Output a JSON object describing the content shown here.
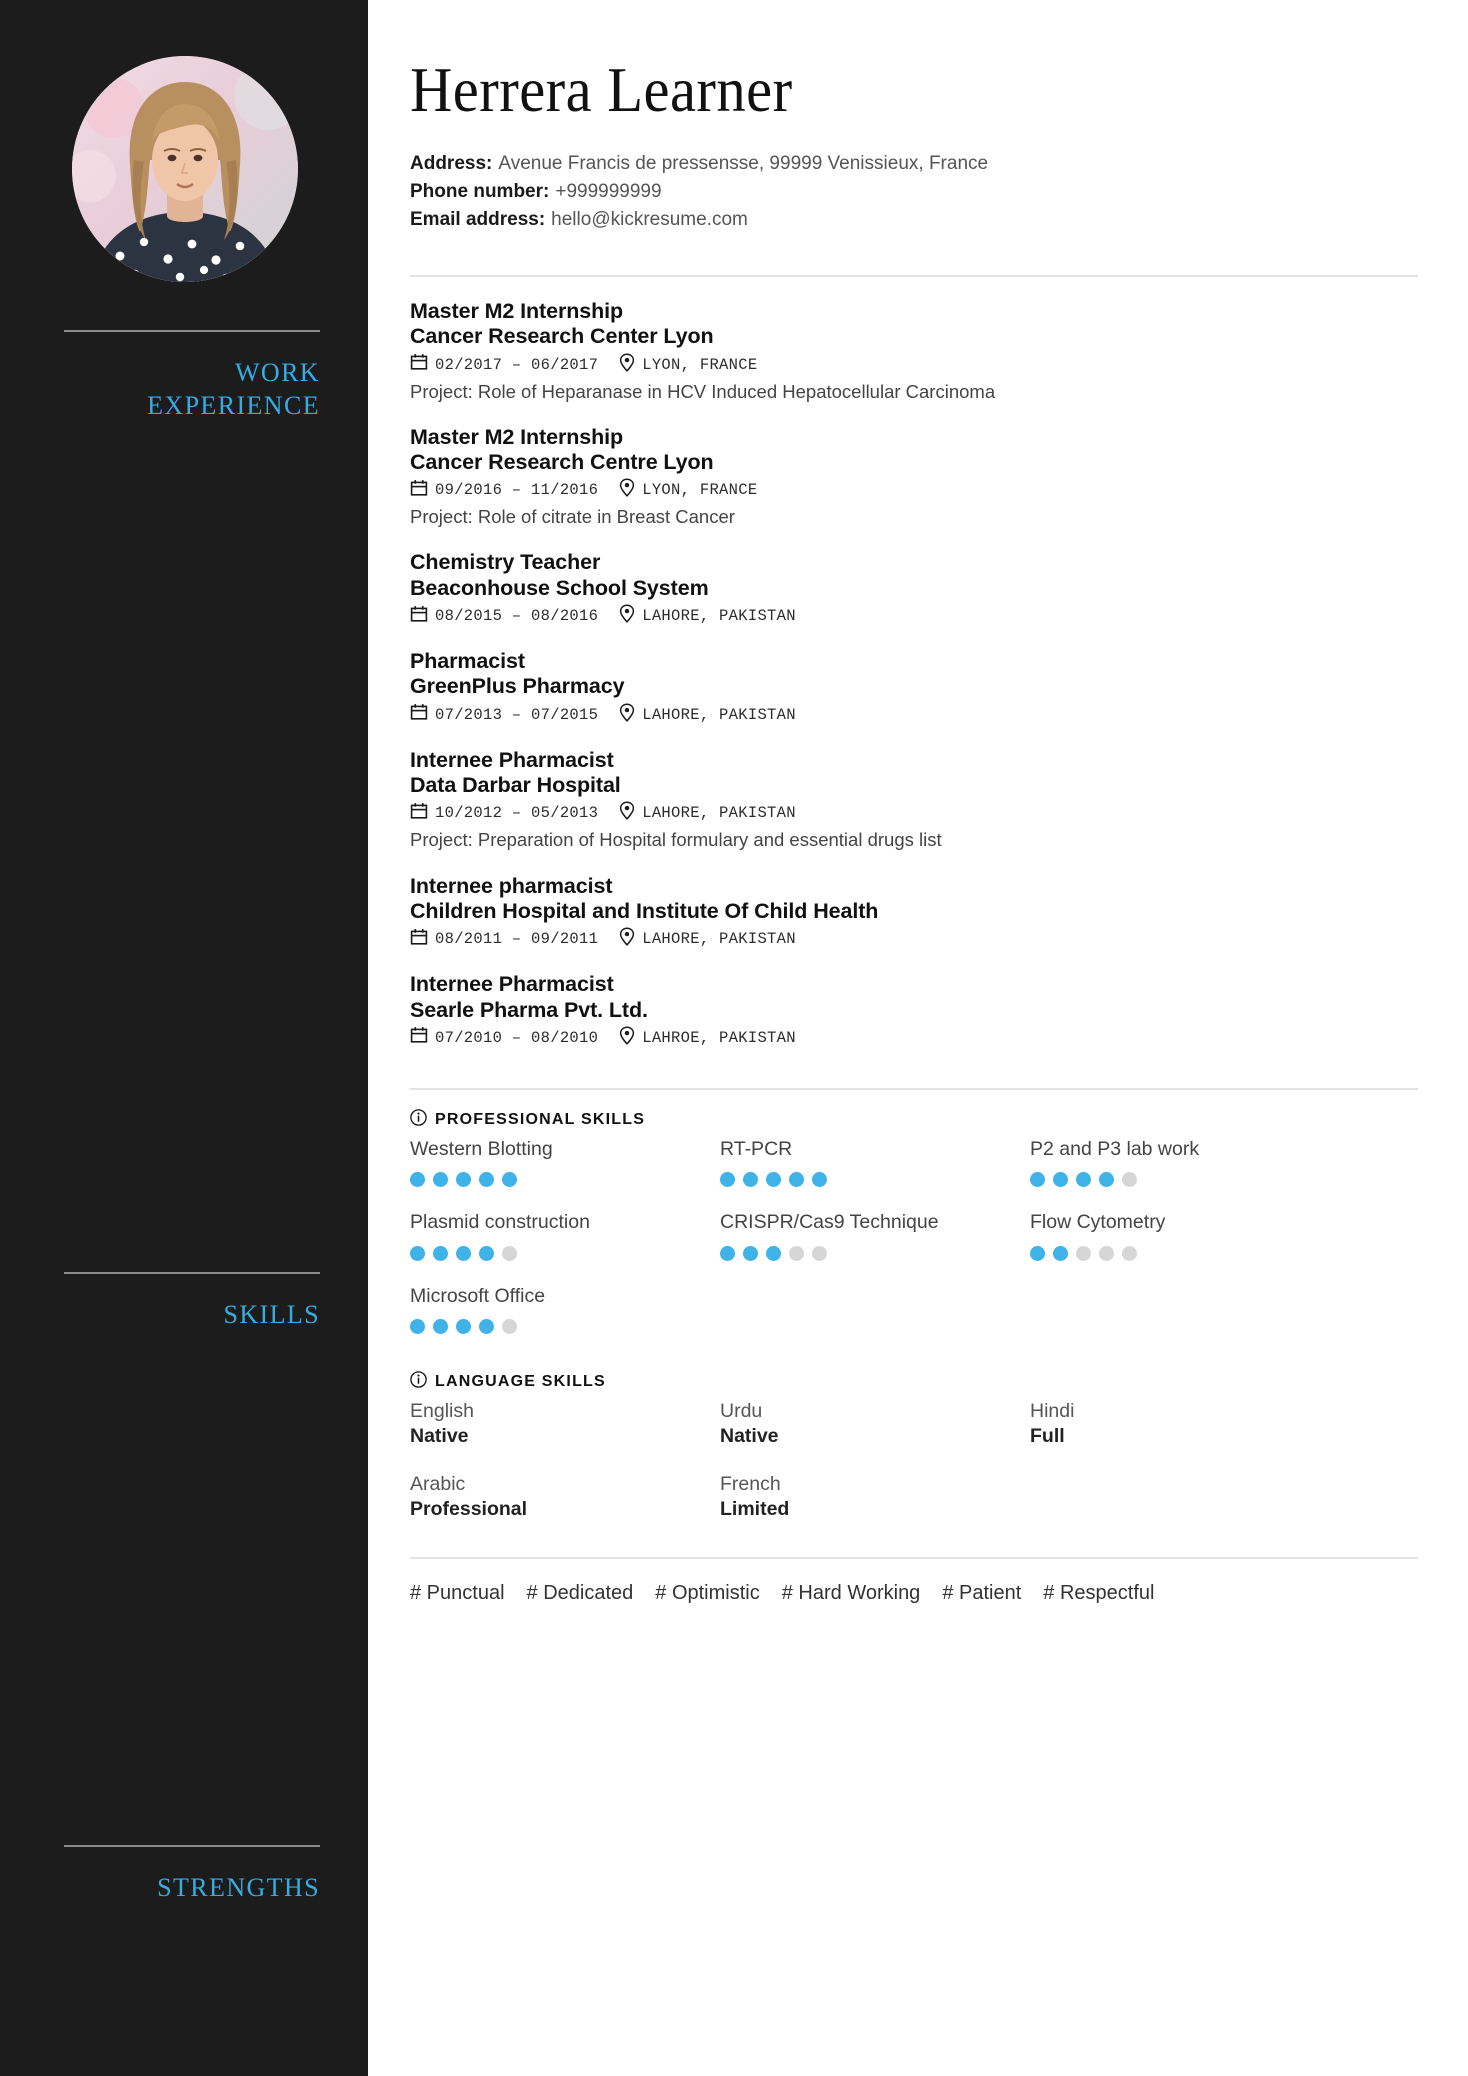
{
  "person": {
    "name": "Herrera Learner"
  },
  "contact": {
    "address_label": "Address:",
    "address_value": "Avenue Francis de pressensse, 99999 Venissieux, France",
    "phone_label": "Phone number:",
    "phone_value": "+999999999",
    "email_label": "Email address:",
    "email_value": "hello@kickresume.com"
  },
  "sidebar": {
    "work_label_line1": "WORK",
    "work_label_line2": "EXPERIENCE",
    "skills_label": "SKILLS",
    "strengths_label": "STRENGTHS"
  },
  "colors": {
    "accent_blue": "#35ade3",
    "dot_on": "#3fb3e8",
    "dot_off": "#d6d6d6",
    "sidebar_bg": "#1c1c1c",
    "divider": "#e2e2e2"
  },
  "experience": [
    {
      "title": "Master M2 Internship",
      "organisation": "Cancer Research Center Lyon",
      "dates": "02/2017 – 06/2017",
      "location": "LYON, FRANCE",
      "description": "Project: Role of Heparanase in HCV Induced Hepatocellular Carcinoma"
    },
    {
      "title": "Master M2 Internship",
      "organisation": "Cancer Research Centre Lyon",
      "dates": "09/2016 – 11/2016",
      "location": "LYON, FRANCE",
      "description": "Project: Role of citrate in Breast Cancer"
    },
    {
      "title": "Chemistry Teacher",
      "organisation": "Beaconhouse School System",
      "dates": "08/2015 – 08/2016",
      "location": "LAHORE, PAKISTAN",
      "description": ""
    },
    {
      "title": "Pharmacist",
      "organisation": "GreenPlus Pharmacy",
      "dates": "07/2013 – 07/2015",
      "location": "LAHORE, PAKISTAN",
      "description": ""
    },
    {
      "title": "Internee Pharmacist",
      "organisation": "Data Darbar Hospital",
      "dates": "10/2012 – 05/2013",
      "location": "LAHORE, PAKISTAN",
      "description": "Project: Preparation of Hospital formulary and essential drugs list"
    },
    {
      "title": "Internee pharmacist",
      "organisation": "Children Hospital and Institute Of Child Health",
      "dates": "08/2011 – 09/2011",
      "location": "LAHORE, PAKISTAN",
      "description": ""
    },
    {
      "title": "Internee Pharmacist",
      "organisation": "Searle Pharma Pvt. Ltd.",
      "dates": "07/2010 – 08/2010",
      "location": "LAHROE, PAKISTAN",
      "description": ""
    }
  ],
  "professional_skills": {
    "heading": "PROFESSIONAL SKILLS",
    "max_level": 5,
    "items": [
      {
        "name": "Western Blotting",
        "level": 5
      },
      {
        "name": "RT-PCR",
        "level": 5
      },
      {
        "name": "P2 and P3 lab work",
        "level": 4
      },
      {
        "name": "Plasmid construction",
        "level": 4
      },
      {
        "name": "CRISPR/Cas9 Technique",
        "level": 3
      },
      {
        "name": "Flow Cytometry",
        "level": 2
      },
      {
        "name": "Microsoft Office",
        "level": 4
      }
    ]
  },
  "language_skills": {
    "heading": "LANGUAGE SKILLS",
    "items": [
      {
        "name": "English",
        "level": "Native"
      },
      {
        "name": "Urdu",
        "level": "Native"
      },
      {
        "name": "Hindi",
        "level": "Full"
      },
      {
        "name": "Arabic",
        "level": "Professional"
      },
      {
        "name": "French",
        "level": "Limited"
      }
    ]
  },
  "strengths": [
    "# Punctual",
    "# Dedicated",
    "# Optimistic",
    "# Hard Working",
    "# Patient",
    "# Respectful"
  ],
  "icons": {
    "calendar": "calendar-icon",
    "location": "location-pin-icon",
    "info": "info-circle-icon"
  }
}
